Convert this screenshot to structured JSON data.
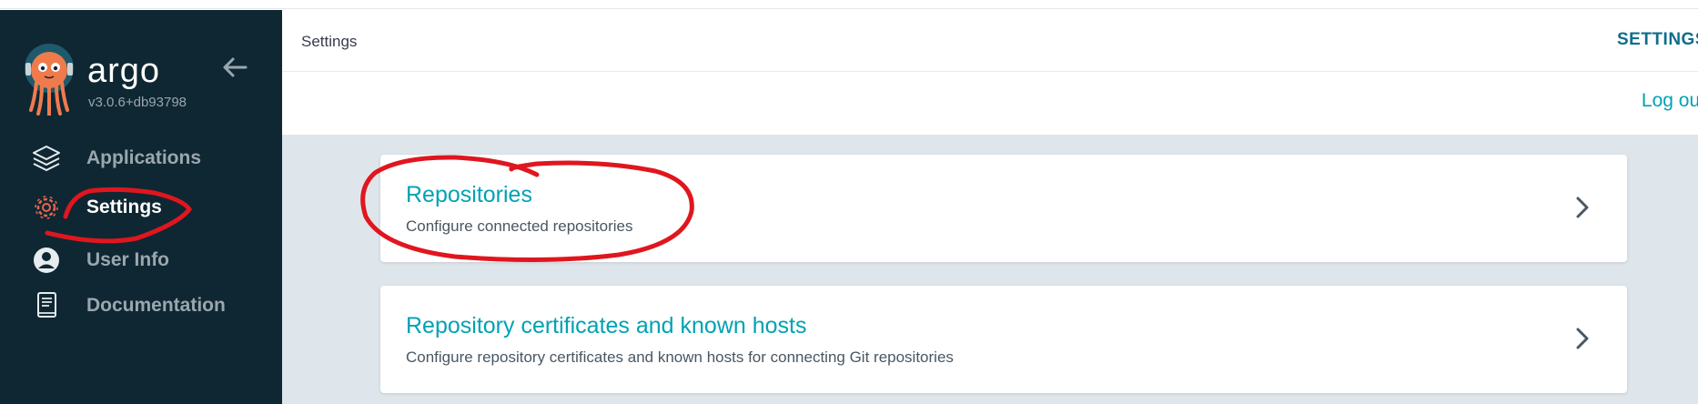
{
  "app": {
    "brand": "argo",
    "version": "v3.0.6+db93798"
  },
  "sidebar": {
    "items": [
      {
        "label": "Applications",
        "icon": "layers-icon",
        "active": false
      },
      {
        "label": "Settings",
        "icon": "gear-icon",
        "active": true
      },
      {
        "label": "User Info",
        "icon": "user-circle-icon",
        "active": false
      },
      {
        "label": "Documentation",
        "icon": "book-icon",
        "active": false
      }
    ]
  },
  "topbar": {
    "title": "Settings",
    "right_label": "SETTINGS"
  },
  "subbar": {
    "logout_label": "Log out"
  },
  "cards": [
    {
      "title": "Repositories",
      "description": "Configure connected repositories"
    },
    {
      "title": "Repository certificates and known hosts",
      "description": "Configure repository certificates and known hosts for connecting Git repositories"
    }
  ],
  "colors": {
    "sidebar_bg": "#0f2733",
    "accent": "#00a2b3",
    "content_bg": "#dee6eb",
    "logo_orange": "#ef7b4d",
    "annotation_red": "#e0161e"
  }
}
